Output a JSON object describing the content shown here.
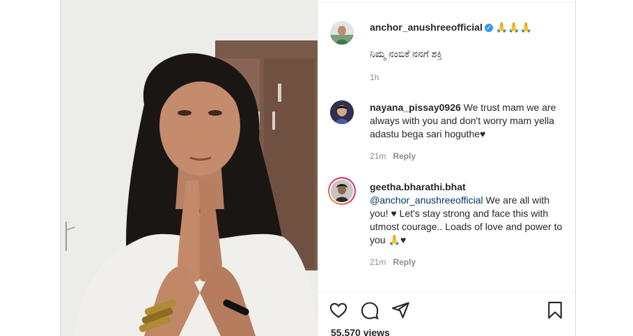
{
  "caption": {
    "username": "anchor_anushreeofficial",
    "emoji": "🙏🙏🙏",
    "text": "ನಿಮ್ಮ ನಂಬಿಕೆ ನನಗೆ ಶಕ್ತಿ",
    "time": "1h"
  },
  "comments": [
    {
      "username": "nayana_pissay0926",
      "text": "We trust mam we are always with you and don't worry mam yella adastu bega sari hoguthe♥",
      "time": "21m",
      "reply_label": "Reply"
    },
    {
      "username": "geetha.bharathi.bhat",
      "mention": "@anchor_anushreeofficial",
      "text": "We are all with you! ♥ Let's stay strong and face this with utmost courage.. Loads of love and power to you 🙏♥",
      "time": "21m",
      "reply_label": "Reply"
    }
  ],
  "stats": {
    "views": "55,570 views"
  },
  "icons": {
    "like": "heart-icon",
    "comment": "comment-icon",
    "share": "paper-plane-icon",
    "save": "bookmark-icon",
    "verified": "verified-badge-icon"
  },
  "colors": {
    "verified": "#3897f0",
    "mention": "#00376b",
    "muted": "#8e8e8e"
  }
}
